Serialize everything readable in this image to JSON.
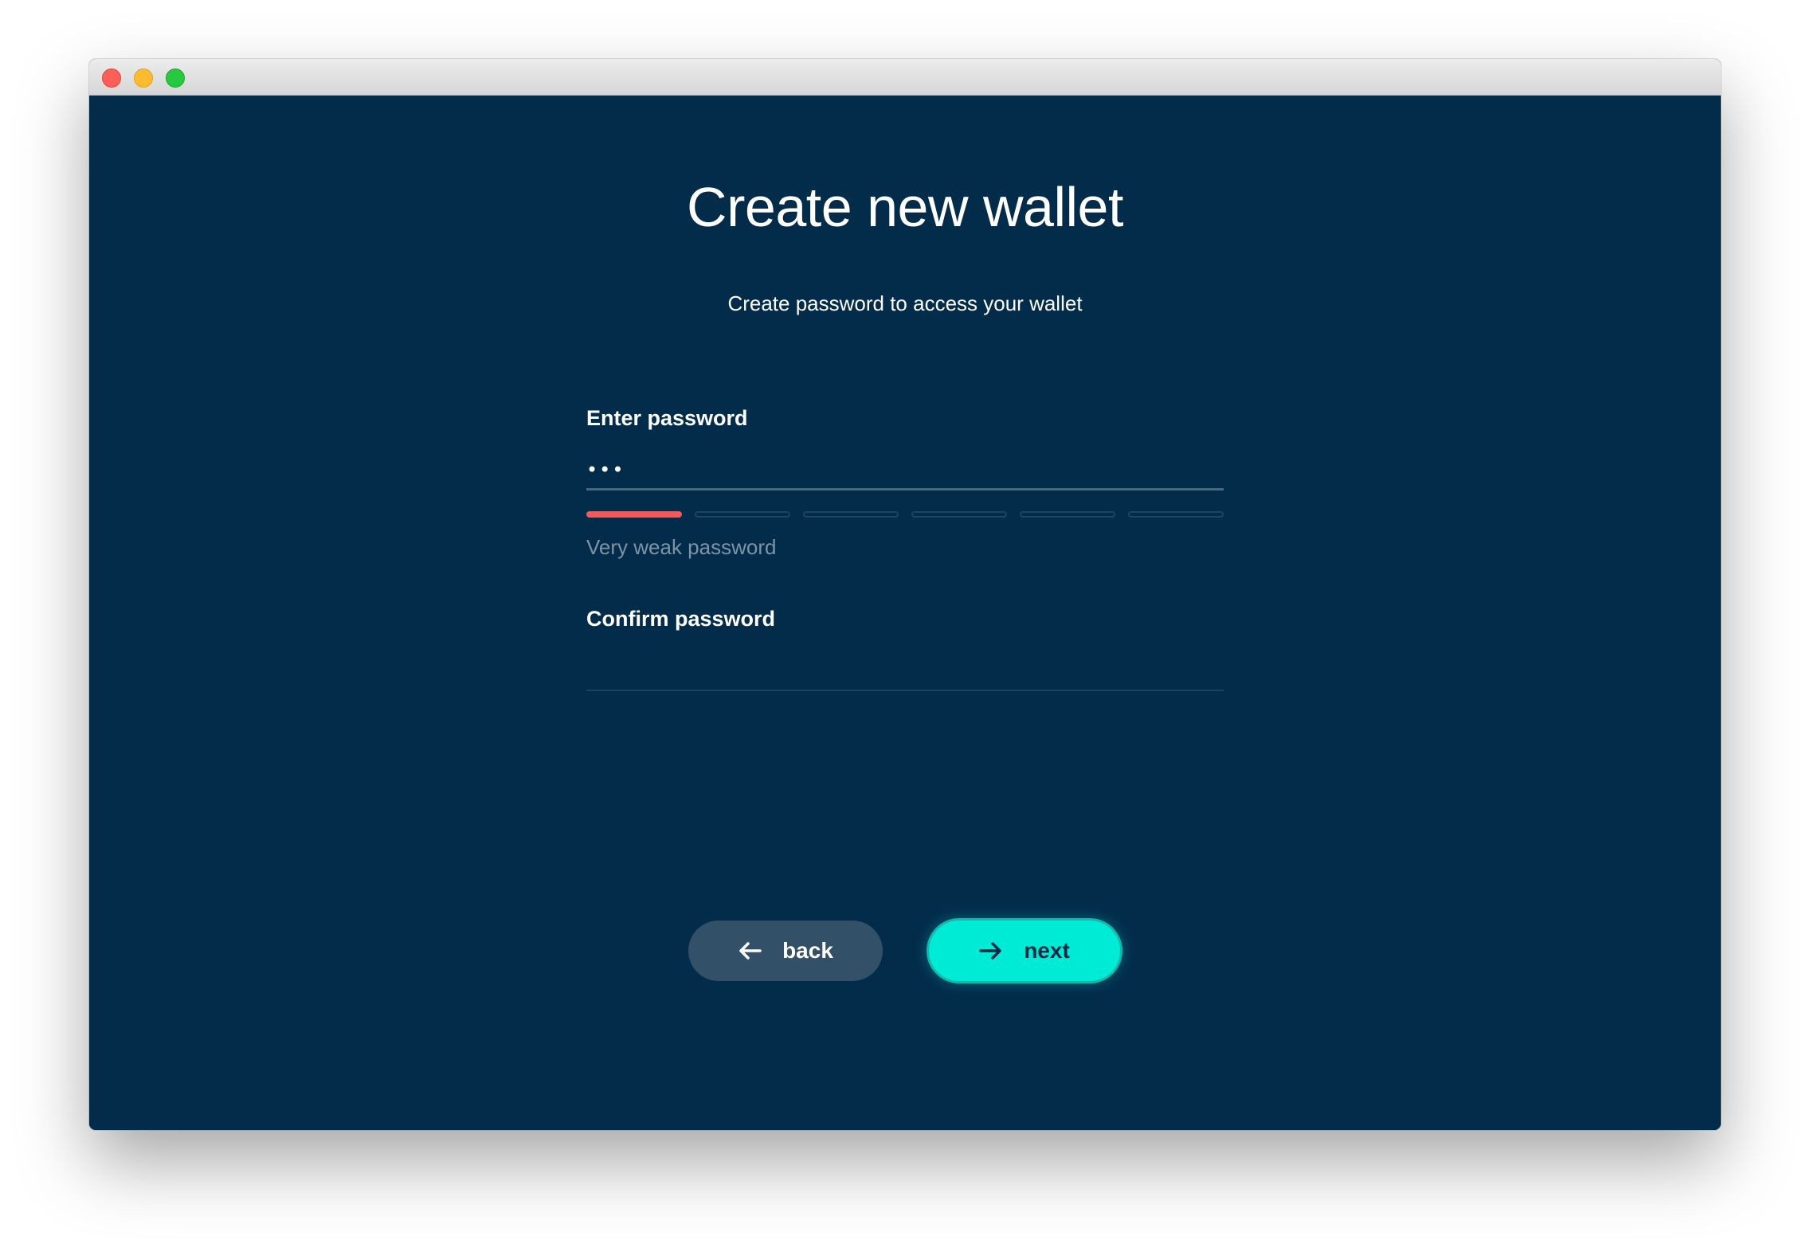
{
  "window": {
    "controls": [
      "close",
      "minimize",
      "maximize"
    ]
  },
  "page": {
    "title": "Create new wallet",
    "subtitle": "Create password to access your wallet"
  },
  "form": {
    "password": {
      "label": "Enter password",
      "value": "•••"
    },
    "strength": {
      "level": 1,
      "segments": 6,
      "text": "Very weak password",
      "color": "#f05a5a"
    },
    "confirm": {
      "label": "Confirm password",
      "value": ""
    }
  },
  "actions": {
    "back_label": "back",
    "back_icon": "arrow-left-icon",
    "next_label": "next",
    "next_icon": "arrow-right-icon"
  },
  "colors": {
    "background": "#032c4b",
    "accent": "#00ebd5",
    "secondary_button": "#325168",
    "weak": "#f05a5a"
  }
}
